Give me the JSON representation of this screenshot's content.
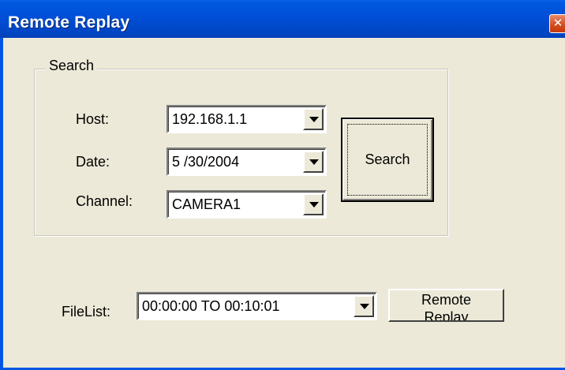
{
  "window": {
    "title": "Remote Replay",
    "close_glyph": "✕"
  },
  "search_group": {
    "label": "Search",
    "host": {
      "label": "Host:",
      "value": "192.168.1.1"
    },
    "date": {
      "label": "Date:",
      "value": "5 /30/2004"
    },
    "channel": {
      "label": "Channel:",
      "value": "CAMERA1"
    },
    "search_button": "Search"
  },
  "filelist": {
    "label": "FileList:",
    "value": "00:00:00 TO 00:10:01"
  },
  "remote_replay_button": {
    "line1": "Remote",
    "line2": "Replay"
  },
  "icons": {
    "close": "close-icon",
    "dropdown": "chevron-down-icon"
  },
  "colors": {
    "titlebar": "#0050d8",
    "dialog_bg": "#ece9d8",
    "close_button": "#d24a1c"
  }
}
